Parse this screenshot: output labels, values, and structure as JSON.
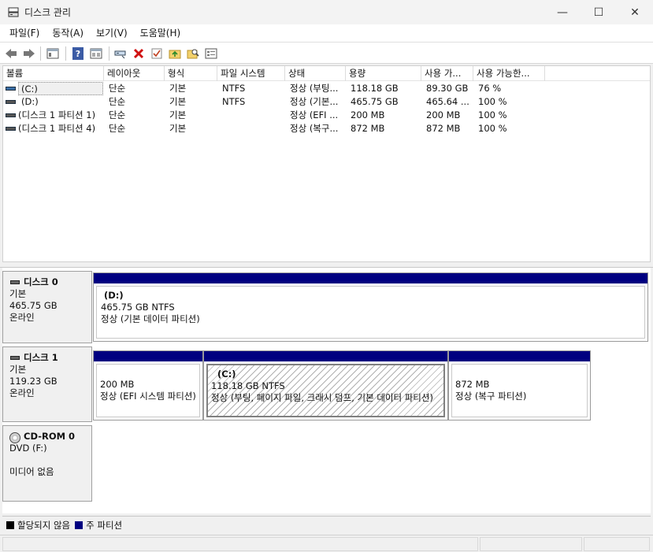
{
  "window": {
    "title": "디스크 관리",
    "minimize": "—",
    "maximize": "☐",
    "close": "✕"
  },
  "menu": [
    "파일(F)",
    "동작(A)",
    "보기(V)",
    "도움말(H)"
  ],
  "toolbar": [
    {
      "icon": "back-arrow-icon"
    },
    {
      "icon": "forward-arrow-icon"
    },
    {
      "icon": "show-hide-console-tree-icon"
    },
    {
      "icon": "help-icon"
    },
    {
      "icon": "properties-view-icon"
    },
    {
      "icon": "connect-drive-icon"
    },
    {
      "icon": "delete-icon"
    },
    {
      "icon": "checkmark-icon"
    },
    {
      "icon": "open-folder-icon"
    },
    {
      "icon": "search-icon"
    },
    {
      "icon": "properties-icon"
    }
  ],
  "volumes": {
    "columns": [
      "볼륨",
      "레이아웃",
      "형식",
      "파일 시스템",
      "상태",
      "용량",
      "사용 가...",
      "사용 가능한..."
    ],
    "rows": [
      [
        "(C:)",
        "단순",
        "기본",
        "NTFS",
        "정상 (부팅...",
        "118.18 GB",
        "89.30 GB",
        "76 %"
      ],
      [
        "(D:)",
        "단순",
        "기본",
        "NTFS",
        "정상 (기본...",
        "465.75 GB",
        "465.64 ...",
        "100 %"
      ],
      [
        "(디스크 1 파티션 1)",
        "단순",
        "기본",
        "",
        "정상 (EFI ...",
        "200 MB",
        "200 MB",
        "100 %"
      ],
      [
        "(디스크 1 파티션 4)",
        "단순",
        "기본",
        "",
        "정상 (복구...",
        "872 MB",
        "872 MB",
        "100 %"
      ]
    ]
  },
  "disks": [
    {
      "name": "디스크 0",
      "type": "기본",
      "size": "465.75 GB",
      "state": "온라인",
      "partitions": [
        {
          "title": "(D:)",
          "line1": "465.75 GB NTFS",
          "line2": "정상 (기본 데이터 파티션)"
        }
      ]
    },
    {
      "name": "디스크 1",
      "type": "기본",
      "size": "119.23 GB",
      "state": "온라인",
      "partitions": [
        {
          "title": "",
          "line1": "200 MB",
          "line2": "정상 (EFI 시스템 파티션)"
        },
        {
          "title": "(C:)",
          "line1": "118.18 GB NTFS",
          "line2": "정상 (부팅, 페이지 파일, 크래시 덤프, 기본 데이터 파티션)"
        },
        {
          "title": "",
          "line1": "872 MB",
          "line2": "정상 (복구 파티션)"
        }
      ]
    },
    {
      "name": "CD-ROM 0",
      "type": "DVD (F:)",
      "size": "",
      "state": "미디어 없음"
    }
  ],
  "legend": [
    {
      "label": "할당되지 않음",
      "color": "#000000"
    },
    {
      "label": "주 파티션",
      "color": "#000080"
    }
  ]
}
